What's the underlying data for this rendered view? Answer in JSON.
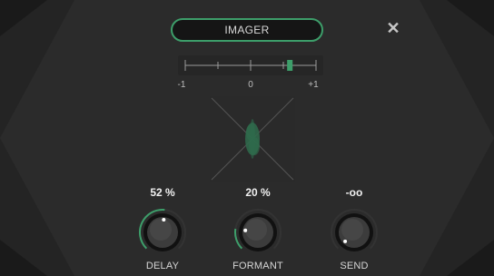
{
  "plugin": {
    "title": "IMAGER",
    "close_icon": "close-icon"
  },
  "meter": {
    "labels": [
      "-1",
      "0",
      "+1"
    ],
    "indicator_value": 0.6
  },
  "knobs": [
    {
      "name": "DELAY",
      "value": "52 %",
      "fill_fraction": 0.52
    },
    {
      "name": "FORMANT",
      "value": "20 %",
      "fill_fraction": 0.2
    },
    {
      "name": "SEND",
      "value": "-oo",
      "fill_fraction": 0.0
    }
  ],
  "colors": {
    "accent": "#3d9e6a",
    "background": "#1c1c1c"
  }
}
